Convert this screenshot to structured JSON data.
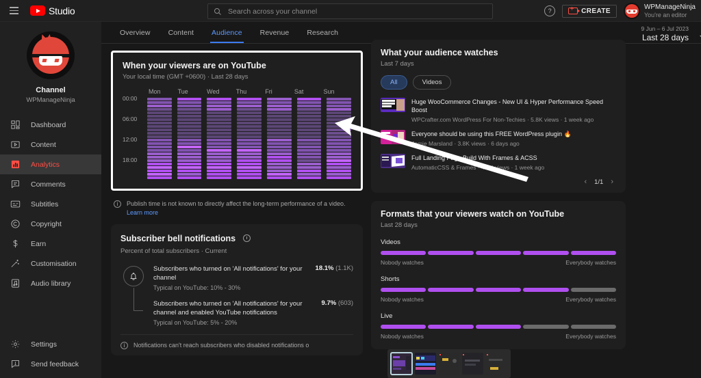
{
  "header": {
    "brand": "Studio",
    "menu_icon": "hamburger-icon",
    "search": {
      "placeholder": "Search across your channel",
      "value": "",
      "icon": "search-icon"
    },
    "help_label": "?",
    "create_label": "CREATE",
    "account": {
      "name": "WPManageNinja",
      "role": "You're an editor"
    }
  },
  "sidebar": {
    "channel_label": "Channel",
    "channel_name": "WPManageNinja",
    "items": [
      {
        "label": "Dashboard",
        "icon": "dashboard-icon",
        "active": false
      },
      {
        "label": "Content",
        "icon": "content-icon",
        "active": false
      },
      {
        "label": "Analytics",
        "icon": "analytics-icon",
        "active": true
      },
      {
        "label": "Comments",
        "icon": "comments-icon",
        "active": false
      },
      {
        "label": "Subtitles",
        "icon": "subtitles-icon",
        "active": false
      },
      {
        "label": "Copyright",
        "icon": "copyright-icon",
        "active": false
      },
      {
        "label": "Earn",
        "icon": "earn-icon",
        "active": false
      },
      {
        "label": "Customisation",
        "icon": "customisation-icon",
        "active": false
      },
      {
        "label": "Audio library",
        "icon": "audio-library-icon",
        "active": false
      }
    ],
    "bottom_items": [
      {
        "label": "Settings",
        "icon": "gear-icon"
      },
      {
        "label": "Send feedback",
        "icon": "feedback-icon"
      }
    ]
  },
  "tabs": [
    {
      "label": "Overview",
      "active": false
    },
    {
      "label": "Content",
      "active": false
    },
    {
      "label": "Audience",
      "active": true
    },
    {
      "label": "Revenue",
      "active": false
    },
    {
      "label": "Research",
      "active": false
    }
  ],
  "date_range": {
    "range": "9 Jun – 6 Jul 2023",
    "preset": "Last 28 days"
  },
  "heatmap_card": {
    "title": "When your viewers are on YouTube",
    "subtitle": "Your local time (GMT +0600) · Last 28 days",
    "note": "Publish time is not known to directly affect the long-term performance of a video.",
    "note_link": "Learn more"
  },
  "chart_data": {
    "type": "heatmap",
    "title": "When your viewers are on YouTube",
    "xlabel": "",
    "ylabel": "",
    "categories": [
      "Mon",
      "Tue",
      "Wed",
      "Thu",
      "Fri",
      "Sat",
      "Sun"
    ],
    "y_tick_labels": [
      "00:00",
      "06:00",
      "12:00",
      "18:00"
    ],
    "y_tick_hours": [
      0,
      6,
      12,
      18
    ],
    "hours": [
      0,
      1,
      2,
      3,
      4,
      5,
      6,
      7,
      8,
      9,
      10,
      11,
      12,
      13,
      14,
      15,
      16,
      17,
      18,
      19,
      20,
      21,
      22,
      23
    ],
    "legend": "Nobody watches to Everybody watches",
    "grid": false,
    "colorscale": [
      "#3d3448",
      "#4a3c5c",
      "#5b4675",
      "#6d4f8e",
      "#8254b0",
      "#9a5ecd",
      "#b04ff0",
      "#c464ff"
    ],
    "values": {
      "Mon": [
        4,
        4,
        5,
        3,
        2,
        2,
        2,
        2,
        2,
        2,
        2,
        2,
        4,
        4,
        4,
        4,
        5,
        5,
        5,
        6,
        7,
        6,
        7,
        6
      ],
      "Tue": [
        6,
        4,
        4,
        3,
        2,
        2,
        2,
        2,
        2,
        2,
        2,
        2,
        4,
        4,
        7,
        4,
        5,
        5,
        5,
        6,
        7,
        6,
        5,
        6
      ],
      "Wed": [
        6,
        4,
        5,
        5,
        2,
        2,
        2,
        2,
        2,
        2,
        2,
        2,
        4,
        4,
        4,
        7,
        5,
        5,
        5,
        6,
        7,
        6,
        6,
        6
      ],
      "Thu": [
        6,
        4,
        5,
        3,
        2,
        2,
        2,
        2,
        2,
        2,
        2,
        2,
        4,
        4,
        4,
        7,
        5,
        5,
        6,
        6,
        7,
        6,
        6,
        6
      ],
      "Fri": [
        5,
        4,
        5,
        5,
        2,
        2,
        2,
        2,
        2,
        2,
        2,
        2,
        5,
        4,
        4,
        4,
        5,
        6,
        6,
        5,
        5,
        5,
        7,
        6
      ],
      "Sat": [
        6,
        4,
        4,
        3,
        2,
        2,
        2,
        2,
        2,
        2,
        2,
        2,
        4,
        3,
        4,
        4,
        4,
        4,
        3,
        5,
        5,
        6,
        5,
        6
      ],
      "Sun": [
        4,
        4,
        4,
        5,
        2,
        2,
        2,
        2,
        2,
        3,
        3,
        3,
        4,
        4,
        4,
        4,
        5,
        5,
        7,
        6,
        5,
        6,
        5,
        6
      ]
    }
  },
  "bell_card": {
    "title": "Subscriber bell notifications",
    "title_icon": "clock-icon",
    "subtitle": "Percent of total subscribers · Current",
    "icon": "bell-icon",
    "rows": [
      {
        "label": "Subscribers who turned on 'All notifications' for your channel",
        "typical": "Typical on YouTube: 10% - 30%",
        "value": "18.1%",
        "count": "(1.1K)"
      },
      {
        "label": "Subscribers who turned on 'All notifications' for your channel and enabled YouTube notifications",
        "typical": "Typical on YouTube: 5% - 20%",
        "value": "9.7%",
        "count": "(603)"
      }
    ],
    "footer_note": "Notifications can't reach subscribers who disabled notifications o"
  },
  "watch_card": {
    "title": "What your audience watches",
    "subtitle": "Last 7 days",
    "chips": [
      {
        "label": "All",
        "active": true
      },
      {
        "label": "Videos",
        "active": false
      }
    ],
    "videos": [
      {
        "title": "Huge WooCommerce Changes - New UI & Hyper Performance Speed Boost",
        "meta": "WPCrafter.com WordPress For Non-Techies · 5.8K views · 1 week ago",
        "thumb_color": "#5b2bbf"
      },
      {
        "title": "Everyone should be using this FREE WordPress plugin 🔥",
        "meta": "Jamie Marsland · 3.8K views · 6 days ago",
        "thumb_color": "#b0247c"
      },
      {
        "title": "Full Landing Page Build With Frames & ACSS",
        "meta": "AutomaticCSS & Frames · 4.8K views · 1 week ago",
        "thumb_color": "#4b2d84"
      }
    ],
    "pager": {
      "prev_icon": "chevron-left-icon",
      "page": "1/1",
      "next_icon": "chevron-right-icon"
    }
  },
  "formats_card": {
    "title": "Formats that your viewers watch on YouTube",
    "subtitle": "Last 28 days",
    "low_label": "Nobody watches",
    "high_label": "Everybody watches",
    "segments_total": 5,
    "items": [
      {
        "label": "Videos",
        "filled": 5
      },
      {
        "label": "Shorts",
        "filled": 4
      },
      {
        "label": "Live",
        "filled": 3
      }
    ]
  },
  "filmstrip": {
    "items": [
      {
        "selected": true,
        "color": "#30283a"
      },
      {
        "selected": false,
        "color": "#1b1b2b"
      },
      {
        "selected": false,
        "color": "#2a2a2a"
      },
      {
        "selected": false,
        "color": "#242428"
      },
      {
        "selected": false,
        "color": "#2b2b2b"
      }
    ]
  },
  "colors": {
    "accent_red": "#ff4e45",
    "accent_blue": "#3b7cf0",
    "purple": "#b04ff0",
    "bg": "#181818",
    "card_bg": "#1f1f1f",
    "sidebar_bg": "#212121"
  }
}
